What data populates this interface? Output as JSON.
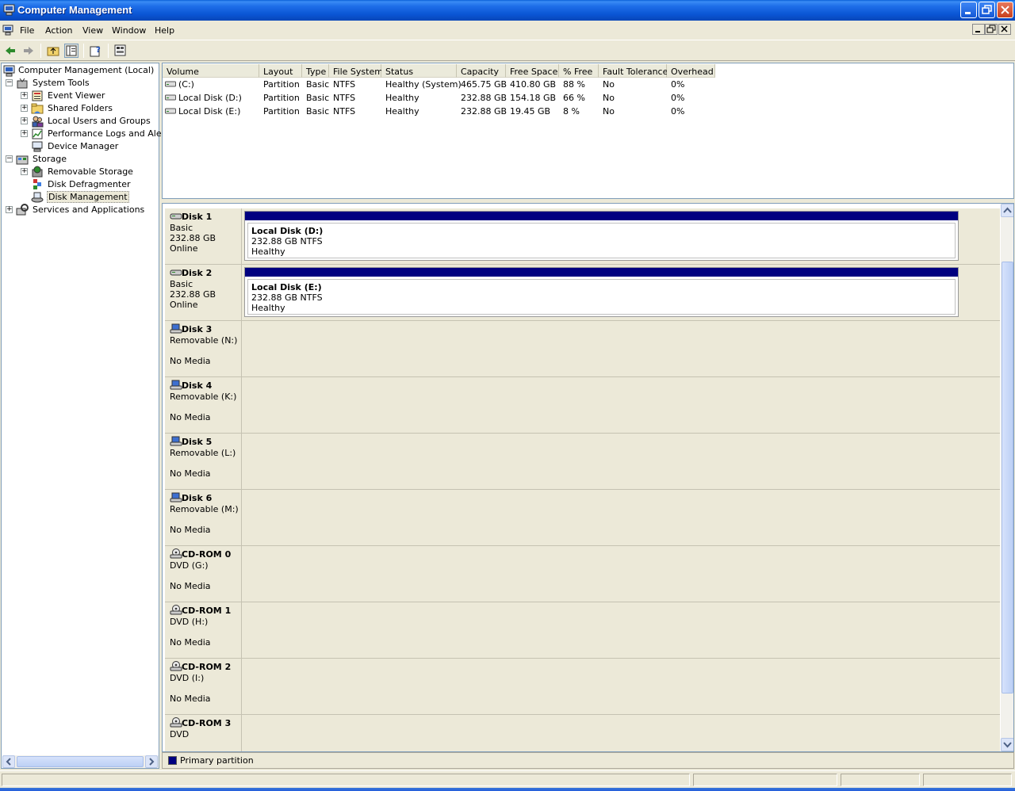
{
  "window": {
    "title": "Computer Management"
  },
  "menu": [
    "File",
    "Action",
    "View",
    "Window",
    "Help"
  ],
  "tree": {
    "root": "Computer Management (Local)",
    "system_tools": "System Tools",
    "event_viewer": "Event Viewer",
    "shared_folders": "Shared Folders",
    "local_users": "Local Users and Groups",
    "perf_logs": "Performance Logs and Alerts",
    "device_manager": "Device Manager",
    "storage": "Storage",
    "removable_storage": "Removable Storage",
    "disk_defrag": "Disk Defragmenter",
    "disk_mgmt": "Disk Management",
    "services": "Services and Applications"
  },
  "volumes": {
    "columns": [
      "Volume",
      "Layout",
      "Type",
      "File System",
      "Status",
      "Capacity",
      "Free Space",
      "% Free",
      "Fault Tolerance",
      "Overhead"
    ],
    "rows": [
      [
        "(C:)",
        "Partition",
        "Basic",
        "NTFS",
        "Healthy (System)",
        "465.75 GB",
        "410.80 GB",
        "88 %",
        "No",
        "0%"
      ],
      [
        "Local Disk (D:)",
        "Partition",
        "Basic",
        "NTFS",
        "Healthy",
        "232.88 GB",
        "154.18 GB",
        "66 %",
        "No",
        "0%"
      ],
      [
        "Local Disk (E:)",
        "Partition",
        "Basic",
        "NTFS",
        "Healthy",
        "232.88 GB",
        "19.45 GB",
        "8 %",
        "No",
        "0%"
      ]
    ]
  },
  "disks": [
    {
      "name": "Disk 1",
      "l1": "Basic",
      "l2": "232.88 GB",
      "l3": "Online",
      "icon": "hard-disk-icon",
      "partition": {
        "name": "Local Disk  (D:)",
        "size": "232.88 GB NTFS",
        "status": "Healthy"
      }
    },
    {
      "name": "Disk 2",
      "l1": "Basic",
      "l2": "232.88 GB",
      "l3": "Online",
      "icon": "hard-disk-icon",
      "partition": {
        "name": "Local Disk  (E:)",
        "size": "232.88 GB NTFS",
        "status": "Healthy"
      }
    },
    {
      "name": "Disk 3",
      "l1": "Removable (N:)",
      "l2": "",
      "l3": "No Media",
      "icon": "removable-disk-icon"
    },
    {
      "name": "Disk 4",
      "l1": "Removable (K:)",
      "l2": "",
      "l3": "No Media",
      "icon": "removable-disk-icon"
    },
    {
      "name": "Disk 5",
      "l1": "Removable (L:)",
      "l2": "",
      "l3": "No Media",
      "icon": "removable-disk-icon"
    },
    {
      "name": "Disk 6",
      "l1": "Removable (M:)",
      "l2": "",
      "l3": "No Media",
      "icon": "removable-disk-icon"
    },
    {
      "name": "CD-ROM 0",
      "l1": "DVD (G:)",
      "l2": "",
      "l3": "No Media",
      "icon": "cdrom-icon"
    },
    {
      "name": "CD-ROM 1",
      "l1": "DVD (H:)",
      "l2": "",
      "l3": "No Media",
      "icon": "cdrom-icon"
    },
    {
      "name": "CD-ROM 2",
      "l1": "DVD (I:)",
      "l2": "",
      "l3": "No Media",
      "icon": "cdrom-icon"
    },
    {
      "name": "CD-ROM 3",
      "l1": "DVD",
      "l2": "",
      "l3": "",
      "icon": "cdrom-icon"
    }
  ],
  "legend": {
    "primary": "Primary partition",
    "color": "#000080"
  }
}
